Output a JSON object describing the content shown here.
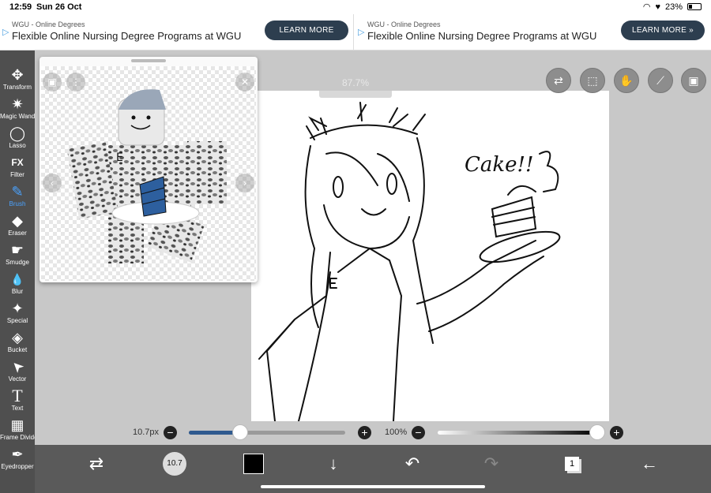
{
  "status": {
    "time": "12:59",
    "date": "Sun 26 Oct",
    "battery": "23%"
  },
  "ads": [
    {
      "source": "WGU - Online Degrees",
      "headline": "Flexible Online Nursing Degree Programs at WGU",
      "button": "LEARN MORE"
    },
    {
      "source": "WGU - Online Degrees",
      "headline": "Flexible Online Nursing Degree Programs at WGU",
      "button": "LEARN MORE »"
    }
  ],
  "tools": [
    {
      "label": "Transform",
      "icon": "✥"
    },
    {
      "label": "Magic Wand",
      "icon": "✷"
    },
    {
      "label": "Lasso",
      "icon": "◯"
    },
    {
      "label": "Filter",
      "icon": "FX"
    },
    {
      "label": "Brush",
      "icon": "✎"
    },
    {
      "label": "Eraser",
      "icon": "◆"
    },
    {
      "label": "Smudge",
      "icon": "☛"
    },
    {
      "label": "Blur",
      "icon": "💧"
    },
    {
      "label": "Special",
      "icon": "✦"
    },
    {
      "label": "Bucket",
      "icon": "◈"
    },
    {
      "label": "Vector",
      "icon": "➤"
    },
    {
      "label": "Text",
      "icon": "T"
    },
    {
      "label": "Frame Divider",
      "icon": "▦"
    },
    {
      "label": "Eyedropper",
      "icon": "✒"
    }
  ],
  "active_tool": "Brush",
  "canvas": {
    "zoom_overlay": "87.7%",
    "sketch_text": "Cake!!"
  },
  "brush": {
    "size": "10.7px",
    "size_level": 0.33,
    "opacity": "100%",
    "opacity_level": 1.0
  },
  "bottom": {
    "brush_preview_size": "10.7",
    "color": "#000000",
    "layers_count": "1"
  }
}
